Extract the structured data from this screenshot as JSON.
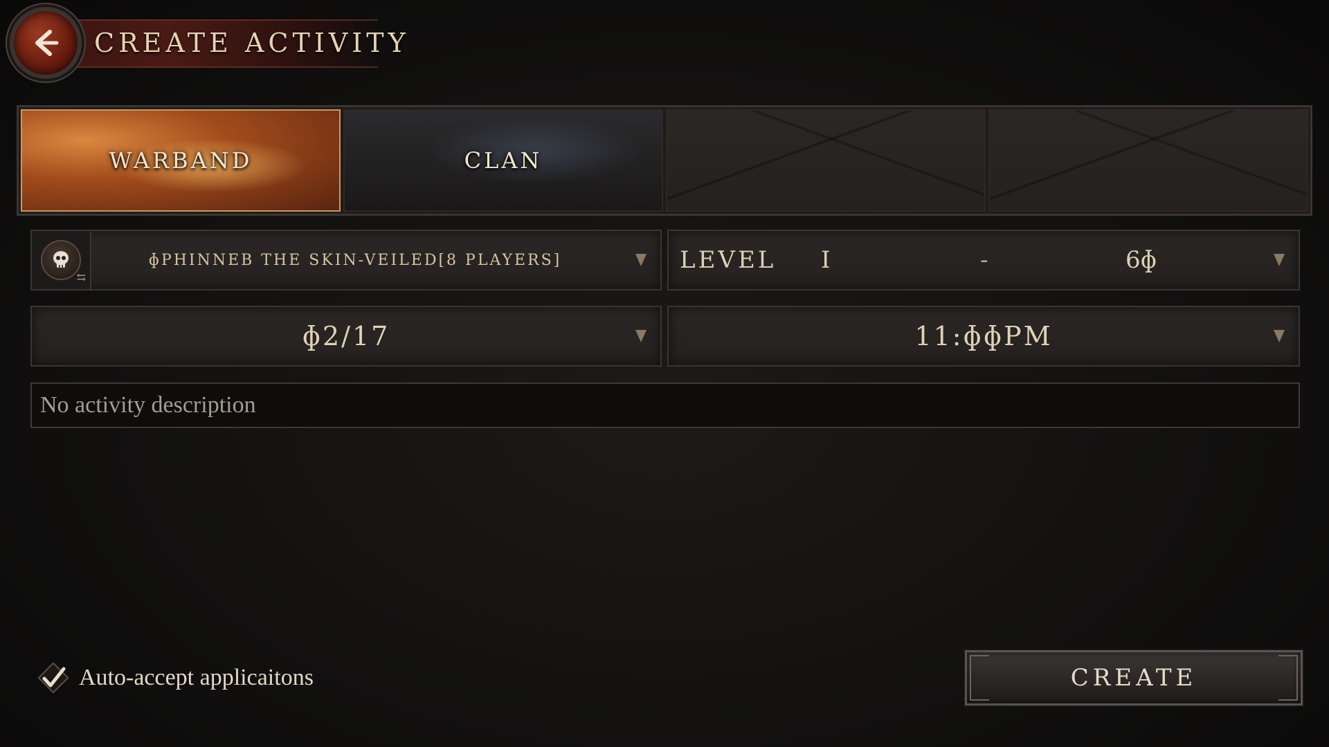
{
  "header": {
    "title": "CREATE ACTIVITY",
    "back_icon": "chevron-left-icon"
  },
  "tabs": [
    {
      "label": "WARBAND",
      "selected": true
    },
    {
      "label": "CLAN",
      "selected": false
    },
    {
      "label": "",
      "selected": false
    },
    {
      "label": "",
      "selected": false
    }
  ],
  "boss_select": {
    "icon": "skull-icon",
    "swap_icon": "swap-icon",
    "value": "ɸPHINNEB THE SKIN-VEILED[8 PLAYERS]"
  },
  "level_range": {
    "label": "LEVEL",
    "min": "I",
    "separator": "-",
    "max": "6ɸ"
  },
  "date_select": {
    "value": "ɸ2/17"
  },
  "time_select": {
    "value": "11:ɸɸPM"
  },
  "description": {
    "placeholder": "No activity description"
  },
  "auto_accept": {
    "label": "Auto-accept applicaitons",
    "checked": true
  },
  "create_button": {
    "label": "CREATE"
  },
  "colors": {
    "accent": "#6b1d0f",
    "text": "#d9c8a6",
    "panel": "#2a2725"
  }
}
